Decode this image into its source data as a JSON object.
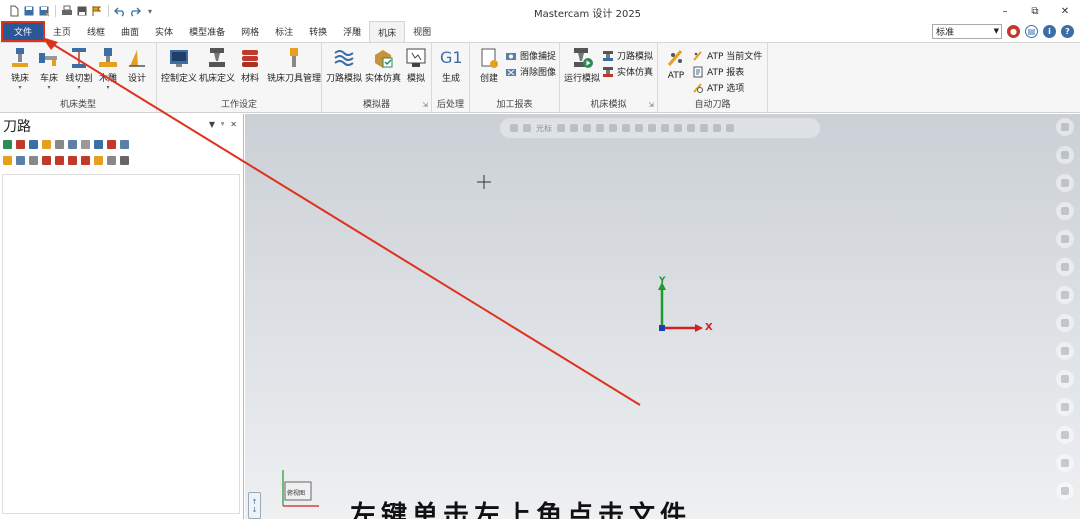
{
  "window": {
    "title": "Mastercam 设计 2025",
    "controls": {
      "minimize": "–",
      "restore": "⧉",
      "close": "✕"
    }
  },
  "quick_access": [
    "new-icon",
    "save-icon",
    "save-as-icon",
    "print-icon",
    "save-disk-icon",
    "flag-icon",
    "undo-icon",
    "redo-icon"
  ],
  "tabs": {
    "file": "文件",
    "items": [
      "主页",
      "线框",
      "曲面",
      "实体",
      "模型准备",
      "网格",
      "标注",
      "转换",
      "浮雕",
      "机床",
      "视图"
    ],
    "active": "机床"
  },
  "mode": {
    "value": "标准"
  },
  "ribbon": {
    "groups": {
      "machine_type": {
        "title": "机床类型",
        "buttons": [
          "铣床",
          "车床",
          "线切割",
          "木雕",
          "设计"
        ]
      },
      "work_setup": {
        "title": "工作设定",
        "buttons": [
          "控制定义",
          "机床定义",
          "材料",
          "铣床刀具管理"
        ]
      },
      "simulator": {
        "title": "模拟器",
        "buttons": [
          "刀路模拟",
          "实体仿真",
          "模拟"
        ]
      },
      "post": {
        "title": "后处理",
        "buttons": [
          "生成"
        ],
        "g1": "G1"
      },
      "report": {
        "title": "加工报表",
        "buttons": [
          "创建"
        ],
        "small": [
          "图像捕捉",
          "消除图像"
        ]
      },
      "machine_sim": {
        "title": "机床模拟",
        "buttons": [
          "运行模拟"
        ],
        "small": [
          "刀路模拟",
          "实体仿真"
        ]
      },
      "auto_toolpath": {
        "title": "自动刀路",
        "buttons": [
          "ATP"
        ],
        "small": [
          "ATP 当前文件",
          "ATP 报表",
          "ATP 选项"
        ]
      }
    }
  },
  "left_panel": {
    "title": "刀路",
    "ctrls": {
      "menu": "▼",
      "pin": "ᵠ",
      "close": "✕"
    }
  },
  "viewport": {
    "toolbar_label": "光标",
    "axis_x": "X",
    "axis_y": "Y",
    "cube_label": "俯视图"
  },
  "subtitle": "左键单击左上角点击文件",
  "colors": {
    "file_tab": "#2b5797",
    "annotation": "#e0301e",
    "axis_x": "#d42020",
    "axis_y": "#1f9a2f"
  }
}
